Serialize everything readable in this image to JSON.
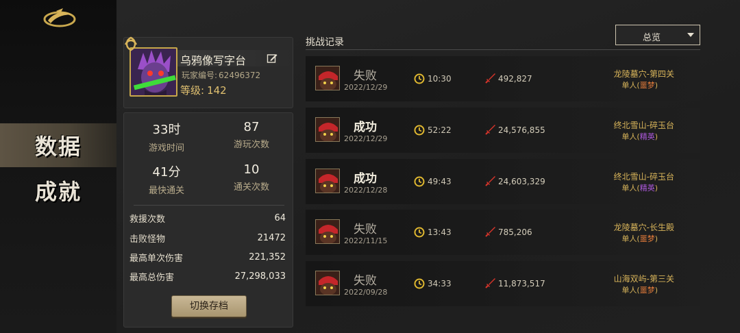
{
  "nav": {
    "items": [
      {
        "label": "数据",
        "active": true
      },
      {
        "label": "成就",
        "active": false
      }
    ]
  },
  "profile": {
    "name": "乌鸦像写字台",
    "id_label": "玩家编号:",
    "id_value": "62496372",
    "level_label": "等级:",
    "level_value": "142"
  },
  "stats": {
    "grid": [
      {
        "value": "33时",
        "label": "游戏时间"
      },
      {
        "value": "87",
        "label": "游玩次数"
      },
      {
        "value": "41分",
        "label": "最快通关"
      },
      {
        "value": "10",
        "label": "通关次数"
      }
    ],
    "rows": [
      {
        "key": "救援次数",
        "value": "64"
      },
      {
        "key": "击败怪物",
        "value": "21472"
      },
      {
        "key": "最高单次伤害",
        "value": "221,352"
      },
      {
        "key": "最高总伤害",
        "value": "27,298,033"
      }
    ],
    "switch_label": "切换存档"
  },
  "records": {
    "title": "挑战记录",
    "filter": "总览",
    "items": [
      {
        "result": "失败",
        "win": false,
        "date": "2022/12/29",
        "time": "10:30",
        "damage": "492,827",
        "stage": "龙陵墓穴-第四关",
        "mode": "单人(",
        "difficulty": "噩梦",
        "mode_end": ")",
        "diff_type": "nightmare"
      },
      {
        "result": "成功",
        "win": true,
        "date": "2022/12/29",
        "time": "52:22",
        "damage": "24,576,855",
        "stage": "终北雪山-碎玉台",
        "mode": "单人(",
        "difficulty": "精英",
        "mode_end": ")",
        "diff_type": "elite"
      },
      {
        "result": "成功",
        "win": true,
        "date": "2022/12/28",
        "time": "49:43",
        "damage": "24,603,329",
        "stage": "终北雪山-碎玉台",
        "mode": "单人(",
        "difficulty": "精英",
        "mode_end": ")",
        "diff_type": "elite"
      },
      {
        "result": "失败",
        "win": false,
        "date": "2022/11/15",
        "time": "13:43",
        "damage": "785,206",
        "stage": "龙陵墓穴-长生殿",
        "mode": "单人(",
        "difficulty": "噩梦",
        "mode_end": ")",
        "diff_type": "nightmare"
      },
      {
        "result": "失败",
        "win": false,
        "date": "2022/09/28",
        "time": "34:33",
        "damage": "11,873,517",
        "stage": "山海双屿-第三关",
        "mode": "单人(",
        "difficulty": "噩梦",
        "mode_end": ")",
        "diff_type": "nightmare"
      }
    ]
  },
  "colors": {
    "accent_gold": "#d8b45a",
    "nightmare": "#e07a3a",
    "elite": "#b05ae0"
  }
}
